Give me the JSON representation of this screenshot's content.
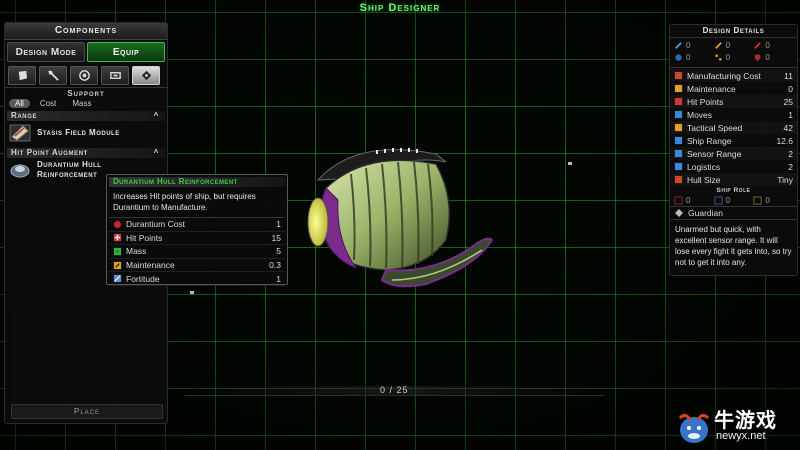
{
  "screen_title": "Ship Designer",
  "left_panel": {
    "header": "Components",
    "modes": [
      {
        "label": "Design Mode",
        "active": false
      },
      {
        "label": "Equip",
        "active": true
      }
    ],
    "tabs": [
      "shield-tab-icon",
      "weapon-tab-icon",
      "engine-tab-icon",
      "module-tab-icon",
      "support-tab-icon"
    ],
    "support_label": "Support",
    "sort": {
      "all": "All",
      "cost": "Cost",
      "mass": "Mass"
    },
    "range_section": "Range",
    "range_item": "Stasis Field Module",
    "hp_section": "Hit Point Augment",
    "hp_item_line1": "Durantium Hull",
    "hp_item_line2": "Reinforcement",
    "place_button": "Place"
  },
  "tooltip": {
    "title": "Durantium Hull Reinforcement",
    "description": "Increases Hit points of ship, but requires Durantium to Manufacture.",
    "rows": [
      {
        "name": "Durantium Cost",
        "value": "1",
        "icon": "durantium-icon",
        "color": "#c82828"
      },
      {
        "name": "Hit Points",
        "value": "15",
        "icon": "hit-points-icon",
        "color": "#d23a3a"
      },
      {
        "name": "Mass",
        "value": "5",
        "icon": "mass-icon",
        "color": "#3fae4a"
      },
      {
        "name": "Maintenance",
        "value": "0.3",
        "icon": "maintenance-icon",
        "color": "#e0a020"
      },
      {
        "name": "Fortitude",
        "value": "1",
        "icon": "fortitude-icon",
        "color": "#6a8bd8"
      }
    ]
  },
  "design_details": {
    "title": "Design Details",
    "weapons": [
      {
        "icon": "beam-attack-icon",
        "value": "0"
      },
      {
        "icon": "missile-attack-icon",
        "value": "0"
      },
      {
        "icon": "mass-driver-attack-icon",
        "value": "0"
      },
      {
        "icon": "shield-defense-icon",
        "value": "0"
      },
      {
        "icon": "point-defense-icon",
        "value": "0"
      },
      {
        "icon": "armor-defense-icon",
        "value": "0"
      }
    ],
    "stats": [
      {
        "name": "Manufacturing Cost",
        "value": "11"
      },
      {
        "name": "Maintenance",
        "value": "0"
      },
      {
        "name": "Hit Points",
        "value": "25"
      },
      {
        "name": "Moves",
        "value": "1"
      },
      {
        "name": "Tactical Speed",
        "value": "42"
      },
      {
        "name": "Ship Range",
        "value": "12.6"
      },
      {
        "name": "Sensor Range",
        "value": "2"
      },
      {
        "name": "Logistics",
        "value": "2"
      },
      {
        "name": "Hull Size",
        "value": "Tiny"
      }
    ],
    "ship_role_title": "Ship Role",
    "role_icons": [
      {
        "icon": "role-attack-icon",
        "value": "0"
      },
      {
        "icon": "role-defense-icon",
        "value": "0"
      },
      {
        "icon": "role-support-icon",
        "value": "0"
      }
    ],
    "role_name": "Guardian",
    "role_description": "Unarmed but quick, with excellent sensor range. It will lose every fight it gets into, so try not to get it into any."
  },
  "counter": "0 / 25",
  "watermark": {
    "cn": "牛游戏",
    "url": "newyx.net"
  }
}
